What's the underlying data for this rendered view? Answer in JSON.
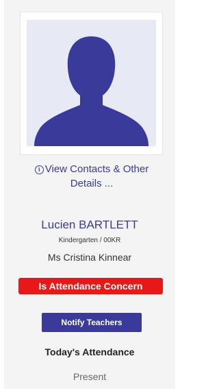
{
  "student": {
    "photo_icon": "person-silhouette-icon",
    "view_contacts_icon": "info-circle-icon",
    "view_contacts_label": "View Contacts & Other Details ...",
    "name": "Lucien BARTLETT",
    "class_info": "Kindergarten / 00KR",
    "teacher": "Ms Cristina Kinnear"
  },
  "alerts": {
    "concern_label": "Is Attendance Concern",
    "concern_color": "#e81818"
  },
  "actions": {
    "notify_label": "Notify Teachers",
    "accent_color": "#3a3a9a"
  },
  "attendance": {
    "heading": "Today's Attendance",
    "status": "Present"
  }
}
